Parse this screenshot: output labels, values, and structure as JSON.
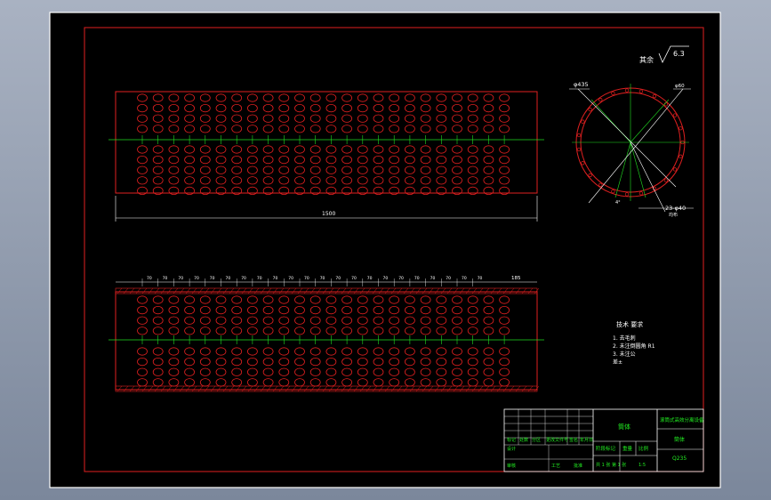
{
  "drawing": {
    "roughness_note": "其余",
    "roughness_value": "6.3",
    "total_length": "1500",
    "pitch_label": "70",
    "end_spacing": "185",
    "outer_diameter": "φ435",
    "hole_diameter": "φ60",
    "hole_callout": "23-φ40",
    "hole_callout_sub": "均布",
    "angle_label": "4°"
  },
  "tech_requirements": {
    "title": "技术 要求",
    "items": [
      "1. 去毛刺",
      "2. 未注倒圆角 R1",
      "3. 未注公",
      "差±"
    ]
  },
  "title_block": {
    "part_name": "筒体",
    "project": "滚筒式高效分离设备",
    "drawing_no": "筒体",
    "material": "Q235",
    "sign_labels": [
      "标记",
      "处数",
      "分区",
      "更改文件号",
      "签名",
      "年月日"
    ],
    "stage_labels": [
      "阶段标记",
      "重量",
      "比例"
    ],
    "design": "设计",
    "audit": "审核",
    "process": "工艺",
    "approve": "批准",
    "scale": "1:5",
    "sheet": "共 1 张 第 1 张"
  }
}
